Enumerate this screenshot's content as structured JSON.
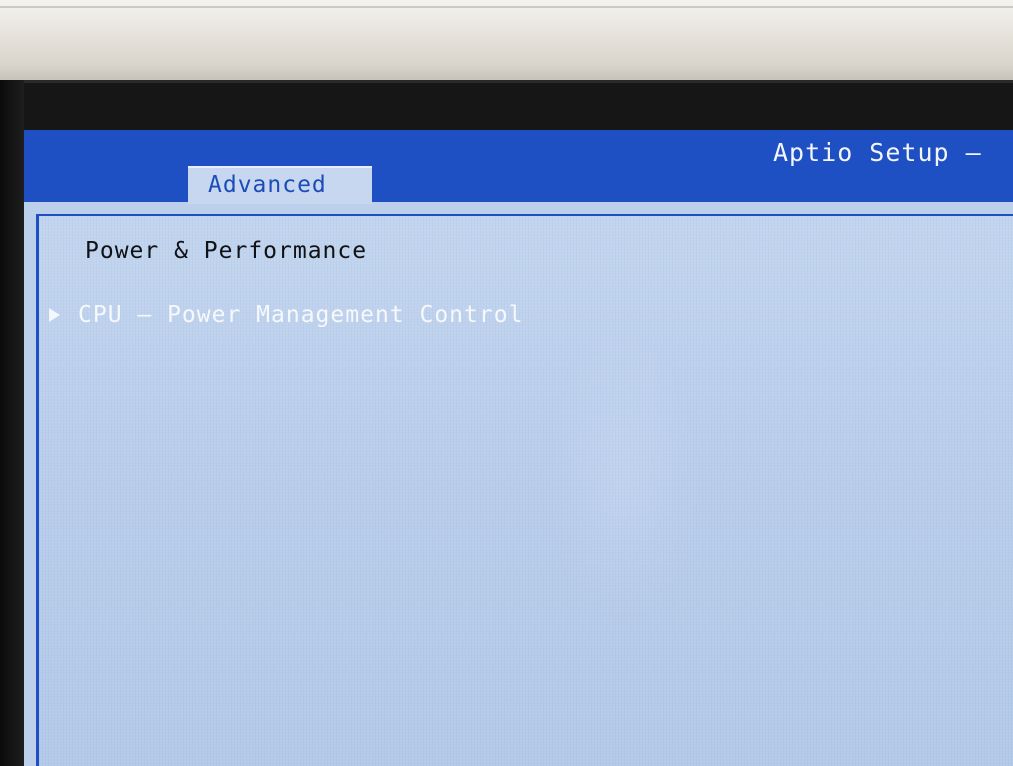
{
  "app": {
    "title": "Aptio Setup –"
  },
  "tabs": [
    {
      "label": "Advanced",
      "active": true
    }
  ],
  "main": {
    "section_title": "Power & Performance",
    "items": [
      {
        "label": "CPU – Power Management Control",
        "icon": "submenu-arrow-icon"
      }
    ]
  },
  "colors": {
    "title_bar": "#1e4fc3",
    "panel_background": "#bcd0ec",
    "active_tab_text": "#1c4cb8",
    "item_text": "#f6f8fc"
  }
}
